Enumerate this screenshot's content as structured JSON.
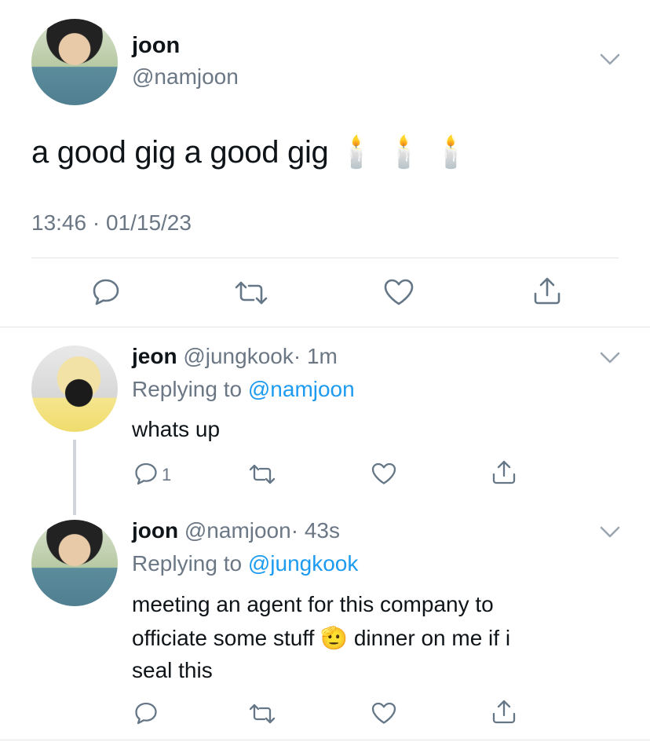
{
  "main_tweet": {
    "name": "joon",
    "handle": "@namjoon",
    "text": "a good gig a good gig 🕯️ 🕯️ 🕯️",
    "timestamp": "13:46 · 01/15/23"
  },
  "replies": [
    {
      "name": "jeon",
      "handle": "@jungkook",
      "time": "· 1m",
      "replying_prefix": "Replying to ",
      "replying_to": "@namjoon",
      "text": "whats up",
      "reply_count": "1"
    },
    {
      "name": "joon",
      "handle": "@namjoon",
      "time": "· 43s",
      "replying_prefix": "Replying to ",
      "replying_to": "@jungkook",
      "text_line1": "meeting an agent for this company to",
      "text_line2": "officiate some stuff 🫡 dinner on me if i",
      "text_line3": "seal this"
    }
  ],
  "icons": {
    "reply": "reply-icon",
    "retweet": "retweet-icon",
    "like": "heart-icon",
    "share": "share-icon",
    "more": "chevron-down-icon"
  },
  "colors": {
    "link": "#1d9bf0",
    "secondary": "#6b7784",
    "divider": "#e3e6e9"
  }
}
